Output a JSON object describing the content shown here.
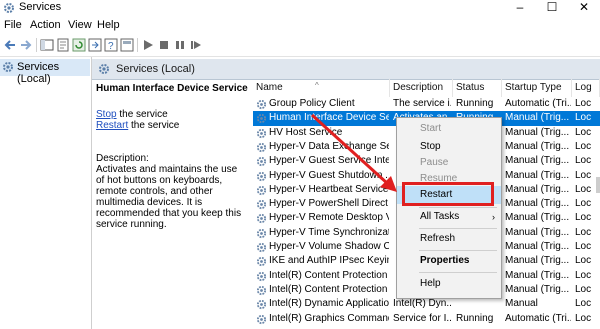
{
  "window": {
    "title": "Services",
    "controls": {
      "minimize": "–",
      "maximize": "☐",
      "close": "✕"
    }
  },
  "menubar": [
    "File",
    "Action",
    "View",
    "Help"
  ],
  "tree": {
    "item": "Services (Local)"
  },
  "pane_header": "Services (Local)",
  "selected_service": {
    "name": "Human Interface Device Service",
    "stop_link": "Stop",
    "stop_suffix": " the service",
    "restart_link": "Restart",
    "restart_suffix": " the service",
    "description_label": "Description:",
    "description": "Activates and maintains the use of hot buttons on keyboards, remote controls, and other multimedia devices. It is recommended that you keep this service running."
  },
  "columns": [
    "Name",
    "Description",
    "Status",
    "Startup Type",
    "Log"
  ],
  "rows": [
    {
      "name": "Group Policy Client",
      "desc": "The service i...",
      "status": "Running",
      "startup": "Automatic (Tri...",
      "log": "Loc"
    },
    {
      "name": "Human Interface Device Ser...",
      "desc": "Activates an...",
      "status": "Running",
      "startup": "Manual (Trig...",
      "log": "Loc"
    },
    {
      "name": "HV Host Service",
      "desc": "",
      "status": "",
      "startup": "Manual (Trig...",
      "log": "Loc"
    },
    {
      "name": "Hyper-V Data Exchange Ser...",
      "desc": "",
      "status": "",
      "startup": "Manual (Trig...",
      "log": "Loc"
    },
    {
      "name": "Hyper-V Guest Service Inter...",
      "desc": "",
      "status": "",
      "startup": "Manual (Trig...",
      "log": "Loc"
    },
    {
      "name": "Hyper-V Guest Shutdown ...",
      "desc": "",
      "status": "",
      "startup": "Manual (Trig...",
      "log": "Loc"
    },
    {
      "name": "Hyper-V Heartbeat Service",
      "desc": "",
      "status": "",
      "startup": "Manual (Trig...",
      "log": "Loc"
    },
    {
      "name": "Hyper-V PowerShell Direct ...",
      "desc": "",
      "status": "",
      "startup": "Manual (Trig...",
      "log": "Loc"
    },
    {
      "name": "Hyper-V Remote Desktop Vi...",
      "desc": "",
      "status": "",
      "startup": "Manual (Trig...",
      "log": "Loc"
    },
    {
      "name": "Hyper-V Time Synchronizati...",
      "desc": "",
      "status": "",
      "startup": "Manual (Trig...",
      "log": "Loc"
    },
    {
      "name": "Hyper-V Volume Shadow C...",
      "desc": "",
      "status": "",
      "startup": "Manual (Trig...",
      "log": "Loc"
    },
    {
      "name": "IKE and AuthIP IPsec Keying...",
      "desc": "",
      "status": "",
      "startup": "Manual (Trig...",
      "log": "Loc"
    },
    {
      "name": "Intel(R) Content Protection ...",
      "desc": "",
      "status": "",
      "startup": "Manual (Trig...",
      "log": "Loc"
    },
    {
      "name": "Intel(R) Content Protection ...",
      "desc": "",
      "status": "",
      "startup": "Manual (Trig...",
      "log": "Loc"
    },
    {
      "name": "Intel(R) Dynamic Applicatio...",
      "desc": "Intel(R) Dyn...",
      "status": "",
      "startup": "Manual",
      "log": "Loc"
    },
    {
      "name": "Intel(R) Graphics Command...",
      "desc": "Service for I...",
      "status": "Running",
      "startup": "Automatic (Tri...",
      "log": "Loc"
    }
  ],
  "context_menu": {
    "start": "Start",
    "stop": "Stop",
    "pause": "Pause",
    "resume": "Resume",
    "restart": "Restart",
    "all_tasks": "All Tasks",
    "refresh": "Refresh",
    "properties": "Properties",
    "help": "Help"
  },
  "colors": {
    "selection": "#0078d7",
    "menu_highlight": "#bfe0f8",
    "annotation": "#e02020"
  }
}
